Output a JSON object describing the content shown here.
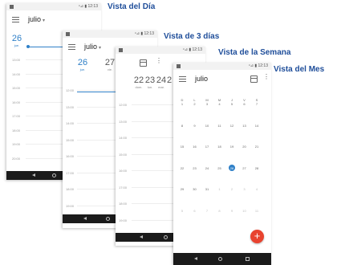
{
  "labels": {
    "day": "Vista del Día",
    "three_day": "Vista de 3 días",
    "week": "Vista de la Semana",
    "month": "Vista del Mes"
  },
  "status_time": "12:13",
  "status_signal": "⁴⊿ ▮",
  "month_name": "julio",
  "caret": "▾",
  "more_glyph": "⋮",
  "day_view": {
    "date": "26",
    "dow": "jue.",
    "hours": [
      "13:00",
      "14:00",
      "15:00",
      "16:00",
      "17:00",
      "18:00",
      "19:00",
      "20:00"
    ]
  },
  "three_day_view": {
    "dates": [
      {
        "num": "26",
        "dow": "jue."
      },
      {
        "num": "27",
        "dow": "vie."
      }
    ],
    "hours": [
      "12:00",
      "13:00",
      "14:00",
      "15:00",
      "16:00",
      "17:00",
      "18:00",
      "19:00"
    ]
  },
  "week_view": {
    "dates": [
      {
        "num": "22",
        "dow": "dom."
      },
      {
        "num": "23",
        "dow": "lun."
      },
      {
        "num": "24",
        "dow": "mar."
      },
      {
        "num": "2",
        "dow": ""
      }
    ],
    "hours": [
      "12:00",
      "13:00",
      "14:00",
      "15:00",
      "16:00",
      "17:00",
      "18:00",
      "19:00"
    ]
  },
  "month_view": {
    "weekdays": [
      "D",
      "L",
      "M",
      "M",
      "J",
      "V",
      "S"
    ],
    "weeks": [
      [
        "1",
        "2",
        "3",
        "4",
        "5",
        "6",
        "7"
      ],
      [
        "8",
        "9",
        "10",
        "11",
        "12",
        "13",
        "14"
      ],
      [
        "15",
        "16",
        "17",
        "18",
        "19",
        "20",
        "21"
      ],
      [
        "22",
        "23",
        "24",
        "25",
        "26",
        "27",
        "28"
      ],
      [
        "29",
        "30",
        "31",
        "1",
        "2",
        "3",
        "4"
      ],
      [
        "5",
        "6",
        "7",
        "8",
        "9",
        "10",
        "11"
      ]
    ],
    "today": "26",
    "fab": "+"
  },
  "colors": {
    "accent": "#2f80c8",
    "label": "#1f4e9a",
    "fab": "#e8432f",
    "navbar": "#1b1b1b"
  }
}
